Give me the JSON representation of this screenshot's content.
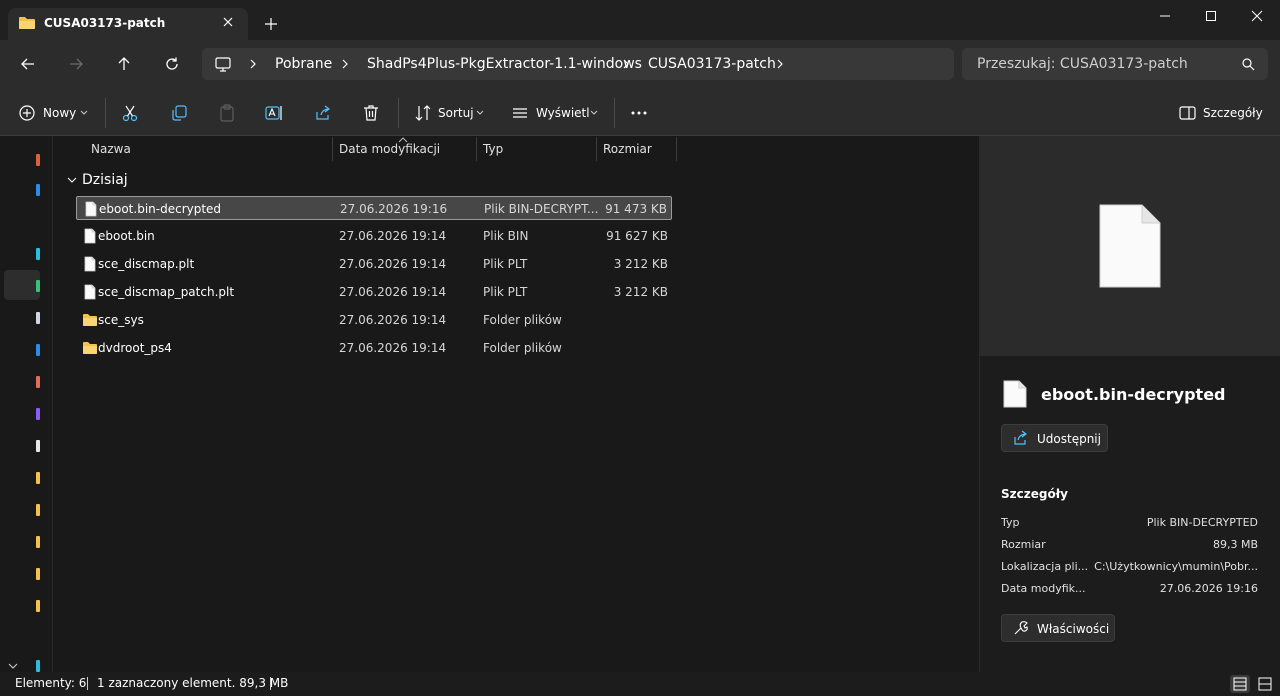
{
  "window": {
    "tab_title": "CUSA03173-patch"
  },
  "address": {
    "crumbs": [
      "Pobrane",
      "ShadPs4Plus-PkgExtractor-1.1-windows",
      "CUSA03173-patch"
    ],
    "search_placeholder": "Przeszukaj: CUSA03173-patch"
  },
  "toolbar": {
    "new_label": "Nowy",
    "sort_label": "Sortuj",
    "view_label": "Wyświetl",
    "details_label": "Szczegóły"
  },
  "columns": {
    "name": "Nazwa",
    "date": "Data modyfikacji",
    "type": "Typ",
    "size": "Rozmiar"
  },
  "group": {
    "label": "Dzisiaj"
  },
  "files": [
    {
      "name": "eboot.bin-decrypted",
      "date": "27.06.2026 19:16",
      "type": "Plik BIN-DECRYPT...",
      "size": "91 473 KB",
      "icon": "file-icon",
      "selected": true
    },
    {
      "name": "eboot.bin",
      "date": "27.06.2026 19:14",
      "type": "Plik BIN",
      "size": "91 627 KB",
      "icon": "file-icon"
    },
    {
      "name": "sce_discmap.plt",
      "date": "27.06.2026 19:14",
      "type": "Plik PLT",
      "size": "3 212 KB",
      "icon": "file-icon"
    },
    {
      "name": "sce_discmap_patch.plt",
      "date": "27.06.2026 19:14",
      "type": "Plik PLT",
      "size": "3 212 KB",
      "icon": "file-icon"
    },
    {
      "name": "sce_sys",
      "date": "27.06.2026 19:14",
      "type": "Folder plików",
      "size": "",
      "icon": "folder-icon"
    },
    {
      "name": "dvdroot_ps4",
      "date": "27.06.2026 19:14",
      "type": "Folder plików",
      "size": "",
      "icon": "folder-icon"
    }
  ],
  "details_pane": {
    "file_name": "eboot.bin-decrypted",
    "share_label": "Udostępnij",
    "section_title": "Szczegóły",
    "props": [
      {
        "key": "Typ",
        "value": "Plik BIN-DECRYPTED"
      },
      {
        "key": "Rozmiar",
        "value": "89,3 MB"
      },
      {
        "key": "Lokalizacja pli...",
        "value": "C:\\Użytkownicy\\mumin\\Pobr..."
      },
      {
        "key": "Data modyfik...",
        "value": "27.06.2026 19:16"
      }
    ],
    "properties_label": "Właściwości"
  },
  "status": {
    "count": "Elementy: 6",
    "selection": "1 zaznaczony element. 89,3 MB"
  },
  "colors": {
    "folder": "#f2c14e",
    "selection_bg": "#474747",
    "accent": "#4cc2ff"
  }
}
